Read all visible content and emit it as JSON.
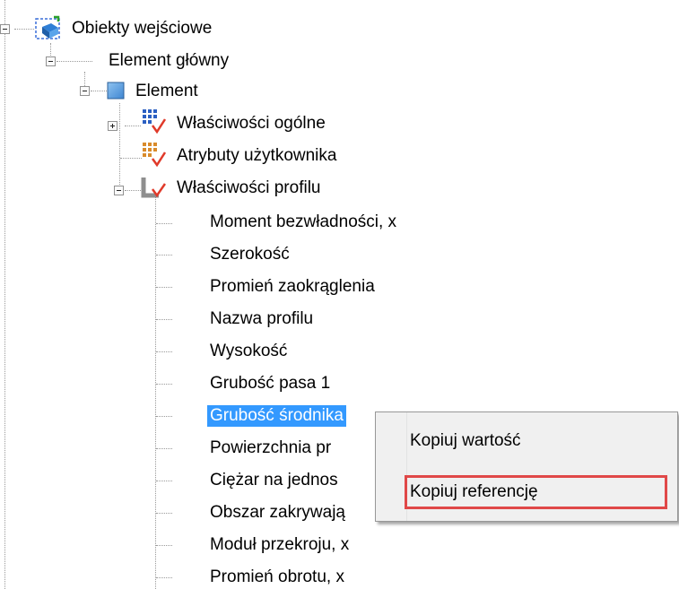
{
  "tree": {
    "root": {
      "label": "Obiekty wejściowe",
      "icon": "input-objects-icon"
    },
    "main_element": {
      "label": "Element główny"
    },
    "element": {
      "label": "Element",
      "icon": "element-square-icon"
    },
    "general_props": {
      "label": "Właściwości ogólne",
      "icon": "properties-grid-icon"
    },
    "user_attrs": {
      "label": "Atrybuty użytkownika",
      "icon": "attributes-grid-icon"
    },
    "profile_props": {
      "label": "Właściwości profilu",
      "icon": "profile-icon"
    },
    "profile_items": [
      "Moment bezwładności, x",
      "Szerokość",
      "Promień zaokrąglenia",
      "Nazwa profilu",
      "Wysokość",
      "Grubość pasa 1",
      "Grubość środnika",
      "Powierzchnia pr",
      "Ciężar na jednos",
      "Obszar zakrywają",
      "Moduł przekroju, x",
      "Promień obrotu, x"
    ],
    "selected_index": 6
  },
  "context_menu": {
    "copy_value": "Kopiuj wartość",
    "copy_reference": "Kopiuj referencję"
  },
  "colors": {
    "selection": "#3399ff",
    "highlight_border": "#e04848",
    "menu_background": "#f0f0f0"
  }
}
